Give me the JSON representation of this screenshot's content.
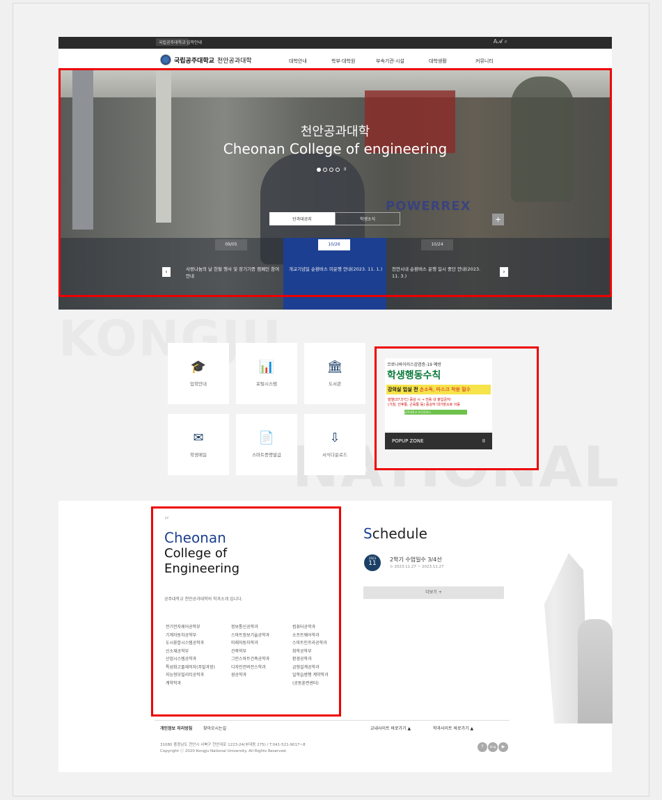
{
  "topbar": {
    "link1": "국립공주대학교",
    "link2": "입학안내",
    "tools": "A𝓐  ⌕"
  },
  "header": {
    "logo_main": "국립공주대학교",
    "logo_sub": "천안공과대학",
    "menu": [
      "대학안내",
      "학부·대학원",
      "부속기관·시설",
      "대학생활",
      "커뮤니티"
    ]
  },
  "hero": {
    "title_ko": "천안공과대학",
    "title_en": "Cheonan College of engineering",
    "pause": "II",
    "brand_text": "POWERREX",
    "notice_tabs": [
      "단과대공지",
      "학생소식"
    ],
    "plus": "+",
    "notices": [
      {
        "date": "09/05",
        "text": "사랑나눔의 날 헌혈 행사 및 장기기증 캠페인 참여 안내"
      },
      {
        "date": "10/26",
        "text": "개교기념일 순환버스 미운행 안내(2023. 11. 1.)"
      },
      {
        "date": "10/24",
        "text": "천안시내 순환버스 운행 일시 중단 안내(2023. 11. 3.)"
      }
    ],
    "prev": "‹",
    "next": "›"
  },
  "bg_text": {
    "kongju": "KONGJU",
    "national": "NATIONAL"
  },
  "quicklinks": [
    {
      "label": "입학안내",
      "icon": "graduation-cap-icon",
      "glyph": "🎓"
    },
    {
      "label": "포털시스템",
      "icon": "chart-monitor-icon",
      "glyph": "📊"
    },
    {
      "label": "도서관",
      "icon": "library-icon",
      "glyph": "🏛"
    },
    {
      "label": "학생메일",
      "icon": "mail-icon",
      "glyph": "✉"
    },
    {
      "label": "스마트증명발급",
      "icon": "certificate-icon",
      "glyph": "📄"
    },
    {
      "label": "서식다운로드",
      "icon": "download-icon",
      "glyph": "⇩"
    }
  ],
  "popup": {
    "small": "코로나바이러스감염증-19 예방",
    "big": "학생행동수칙",
    "rule_a": "강의실 입실 전",
    "rule_b": "손소독, 마스크 착용 필수",
    "note": "발열(37.5℃) 증상 시 → 전용 내 출입금지!\n(기침, 인후통, 근육통 등) 증상자 대기장소로 이동",
    "tag": "공주대학교 보건진료소",
    "footer": "POPUP ZONE",
    "pause": "II"
  },
  "college": {
    "quote": "“",
    "line1": "Cheonan",
    "line2": "College  of",
    "line3": "Engineering",
    "desc": "공주대학교 천안공과대학의 학과소개 입니다.",
    "col1": [
      "전기전자제어공학부",
      "기계자동차공학부",
      "도시융합시스템공학과",
      "신소재공학부",
      "산업시스템공학과",
      "특성화고졸재직자(주말과정)",
      "지능형모빌리티공학과",
      "계약학과"
    ],
    "col2": [
      "정보통신공학과",
      "스마트정보기술공학과",
      "미래자동차학과",
      "건축학부",
      "그린스마트건축공학과",
      "디자인컨버전스학과",
      "광공학과"
    ],
    "col3": [
      "컴퓨터공학과",
      "소프트웨어학과",
      "스마트인프라공학과",
      "화학공학부",
      "환경공학과",
      "금형설계공학과",
      "일학습병행 계약학과",
      "(공동훈련센터)"
    ]
  },
  "schedule": {
    "title_first": "S",
    "title_rest": "chedule",
    "year": "2023",
    "month": "11",
    "event": "2학기 수업일수 3/4선",
    "period": "⊙ 2023.11.27 ~ 2023.11.27",
    "more": "더보기  +"
  },
  "footer": {
    "privacy": "개인정보 처리방침",
    "directions": "찾아오시는길",
    "site1": "교내사이트 바로가기     ▲",
    "site2": "학과사이트 바로가기     ▲",
    "address": "31080 충청남도 천안시 서북구 천안대로 1223-24(부대동 275) / T.041-521-9017~8",
    "copyright": "Copyright ⓒ 2020 Kongju National University. All Rights Reserved.",
    "sns": [
      "f",
      "blog",
      "▶"
    ]
  }
}
